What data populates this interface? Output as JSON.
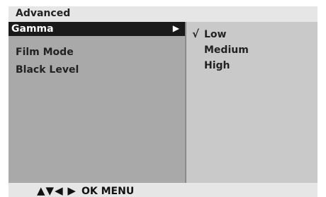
{
  "header": {
    "title": "Advanced"
  },
  "menu": {
    "items": [
      {
        "label": "Gamma",
        "selected": true,
        "arrow": "▶"
      },
      {
        "label": "Film Mode",
        "selected": false
      },
      {
        "label": "Black Level",
        "selected": false
      }
    ]
  },
  "submenu": {
    "check_mark": "√",
    "options": [
      {
        "label": "Low",
        "checked": true
      },
      {
        "label": "Medium",
        "checked": false
      },
      {
        "label": "High",
        "checked": false
      }
    ]
  },
  "footer": {
    "nav_glyphs": "▲▼◀ ▶",
    "nav_text": "OK  MENU"
  },
  "colors": {
    "selected_bg": "#1a1a1a",
    "panel_bg": "#a9a9a9",
    "submenu_bg": "#c9c9c9",
    "header_bg": "#e6e6e6"
  }
}
